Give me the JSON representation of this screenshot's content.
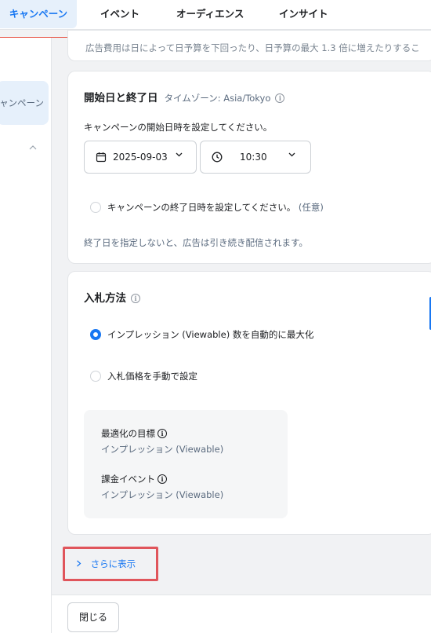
{
  "nav": {
    "tabs": [
      {
        "label": "キャンペーン",
        "active": true
      },
      {
        "label": "イベント",
        "active": false
      },
      {
        "label": "オーディエンス",
        "active": false
      },
      {
        "label": "インサイト",
        "active": false
      }
    ]
  },
  "sidebar": {
    "active_item": "ャンペーン"
  },
  "budget_card": {
    "clipped_text": "広告費用は日によって日予算を下回ったり、日予算の最大 1.3 倍に増えたりするこ"
  },
  "dates_card": {
    "title": "開始日と終了日",
    "timezone": "タイムゾーン: Asia/Tokyo",
    "start_prompt": "キャンペーンの開始日時を設定してください。",
    "start_date": "2025-09-03",
    "start_time": "10:30",
    "end_option": "キャンペーンの終了日時を設定してください。",
    "end_optional": "(任意)",
    "end_note": "終了日を指定しないと、広告は引き続き配信されます。"
  },
  "bid_card": {
    "title": "入札方法",
    "options": [
      {
        "label": "インプレッション (Viewable) 数を自動的に最大化",
        "selected": true
      },
      {
        "label": "入札価格を手動で設定",
        "selected": false
      }
    ],
    "goal_label": "最適化の目標",
    "goal_value": "インプレッション (Viewable)",
    "billing_label": "課金イベント",
    "billing_value": "インプレッション (Viewable)"
  },
  "show_more": {
    "label": "さらに表示"
  },
  "footer": {
    "close_label": "閉じる"
  },
  "colors": {
    "accent": "#1877f2",
    "highlight": "#e0555b"
  }
}
